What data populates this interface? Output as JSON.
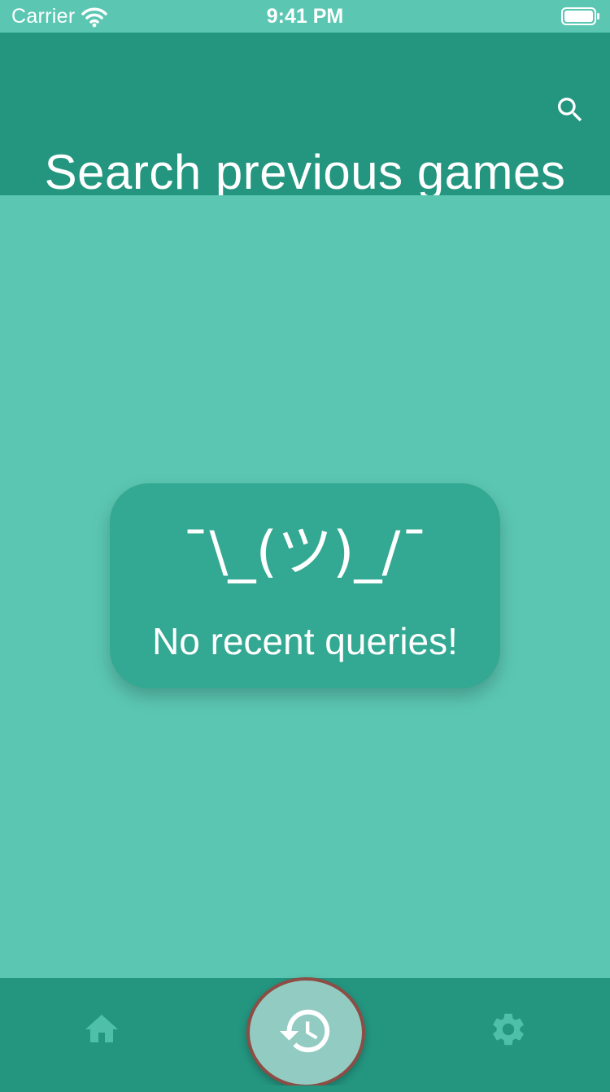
{
  "status_bar": {
    "carrier": "Carrier",
    "time": "9:41 PM",
    "icons": [
      "wifi-icon",
      "battery-icon"
    ]
  },
  "header": {
    "title": "Search previous games",
    "search_icon": "search-icon"
  },
  "empty_state": {
    "shrug": "¯\\_(ツ)_/¯",
    "message": "No recent queries!"
  },
  "bottom_nav": {
    "items": [
      {
        "icon": "home-icon",
        "active": false
      },
      {
        "icon": "history-icon",
        "active": true
      },
      {
        "icon": "gear-icon",
        "active": false
      }
    ]
  },
  "colors": {
    "status_bar_bg": "#5bc7b3",
    "app_bar_bg": "#249680",
    "content_bg": "#5bc7b3",
    "card_bg": "#33a892",
    "nav_icon": "#4fbfa9",
    "active_circle_bg": "#92cbc2",
    "active_circle_border": "#8d4d45",
    "text": "#ffffff"
  }
}
